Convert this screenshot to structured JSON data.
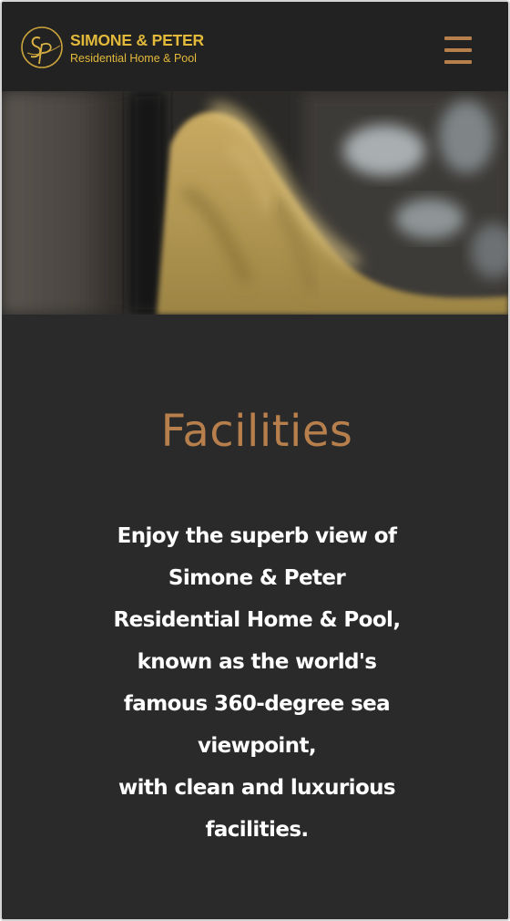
{
  "brand": {
    "title": "SIMONE & PETER",
    "subtitle": "Residential Home & Pool",
    "monogram": "Sp",
    "color": "#e2b93b"
  },
  "header": {
    "menu_icon": "hamburger-menu-icon",
    "accent": "#b77f4b"
  },
  "hero": {
    "image": "blurred-gold-napkin-photo"
  },
  "section": {
    "heading": "Facilities",
    "lines": [
      "Enjoy the superb view of",
      "Simone & Peter",
      "Residential Home & Pool,",
      "known as the world's",
      "famous 360-degree sea",
      "viewpoint,",
      "with clean and luxurious",
      "facilities."
    ]
  }
}
